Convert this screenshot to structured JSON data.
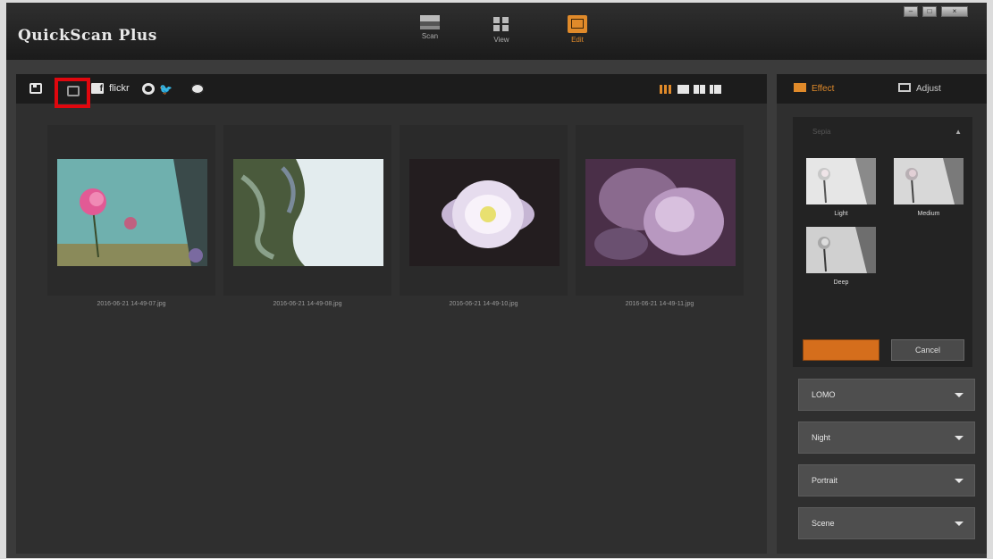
{
  "app": {
    "title": "QuickScan Plus"
  },
  "modes": [
    {
      "label": "Scan",
      "icon": "scanner-icon",
      "active": false
    },
    {
      "label": "View",
      "icon": "view-grid-icon",
      "active": false
    },
    {
      "label": "Edit",
      "icon": "edit-photo-icon",
      "active": true
    }
  ],
  "window_controls": {
    "minimize": "–",
    "maximize": "□",
    "close": "×"
  },
  "toolbar": {
    "icons": [
      "save-icon",
      "camera-icon",
      "facebook-icon",
      "flickr-icon",
      "twitter-icon",
      "settings-icon"
    ],
    "facebook_glyph": "f",
    "flickr_label": "flickr",
    "twitter_glyph": "🐦",
    "view_modes": [
      "grid-view-icon",
      "large-view-icon",
      "two-column-view-icon",
      "single-view-icon"
    ],
    "active_view_mode": "grid-view-icon"
  },
  "thumbnails": [
    {
      "filename": "2016-06-21 14-49-07.jpg",
      "colors": [
        "#5fa0a0",
        "#d85a8a"
      ]
    },
    {
      "filename": "2016-06-21 14-49-08.jpg",
      "colors": [
        "#dfe8ea",
        "#4a5a40"
      ]
    },
    {
      "filename": "2016-06-21 14-49-10.jpg",
      "colors": [
        "#2a2426",
        "#f0e4f0"
      ]
    },
    {
      "filename": "2016-06-21 14-49-11.jpg",
      "colors": [
        "#6a4a6a",
        "#c9a9d0"
      ]
    }
  ],
  "right_panel": {
    "tabs": [
      {
        "label": "Effect",
        "active": true,
        "icon": "effect-icon"
      },
      {
        "label": "Adjust",
        "active": false,
        "icon": "adjust-icon"
      }
    ],
    "effect_group": {
      "header": "Sepia",
      "presets": [
        {
          "label": "Light"
        },
        {
          "label": "Medium"
        },
        {
          "label": "Deep"
        }
      ],
      "apply_label": "",
      "cancel_label": "Cancel"
    },
    "dropdowns": [
      {
        "label": "LOMO"
      },
      {
        "label": "Night"
      },
      {
        "label": "Portrait"
      },
      {
        "label": "Scene"
      }
    ]
  },
  "colors": {
    "accent": "#e08a2a",
    "highlight_box": "#e0070e",
    "apply_button": "#d56e1c"
  }
}
